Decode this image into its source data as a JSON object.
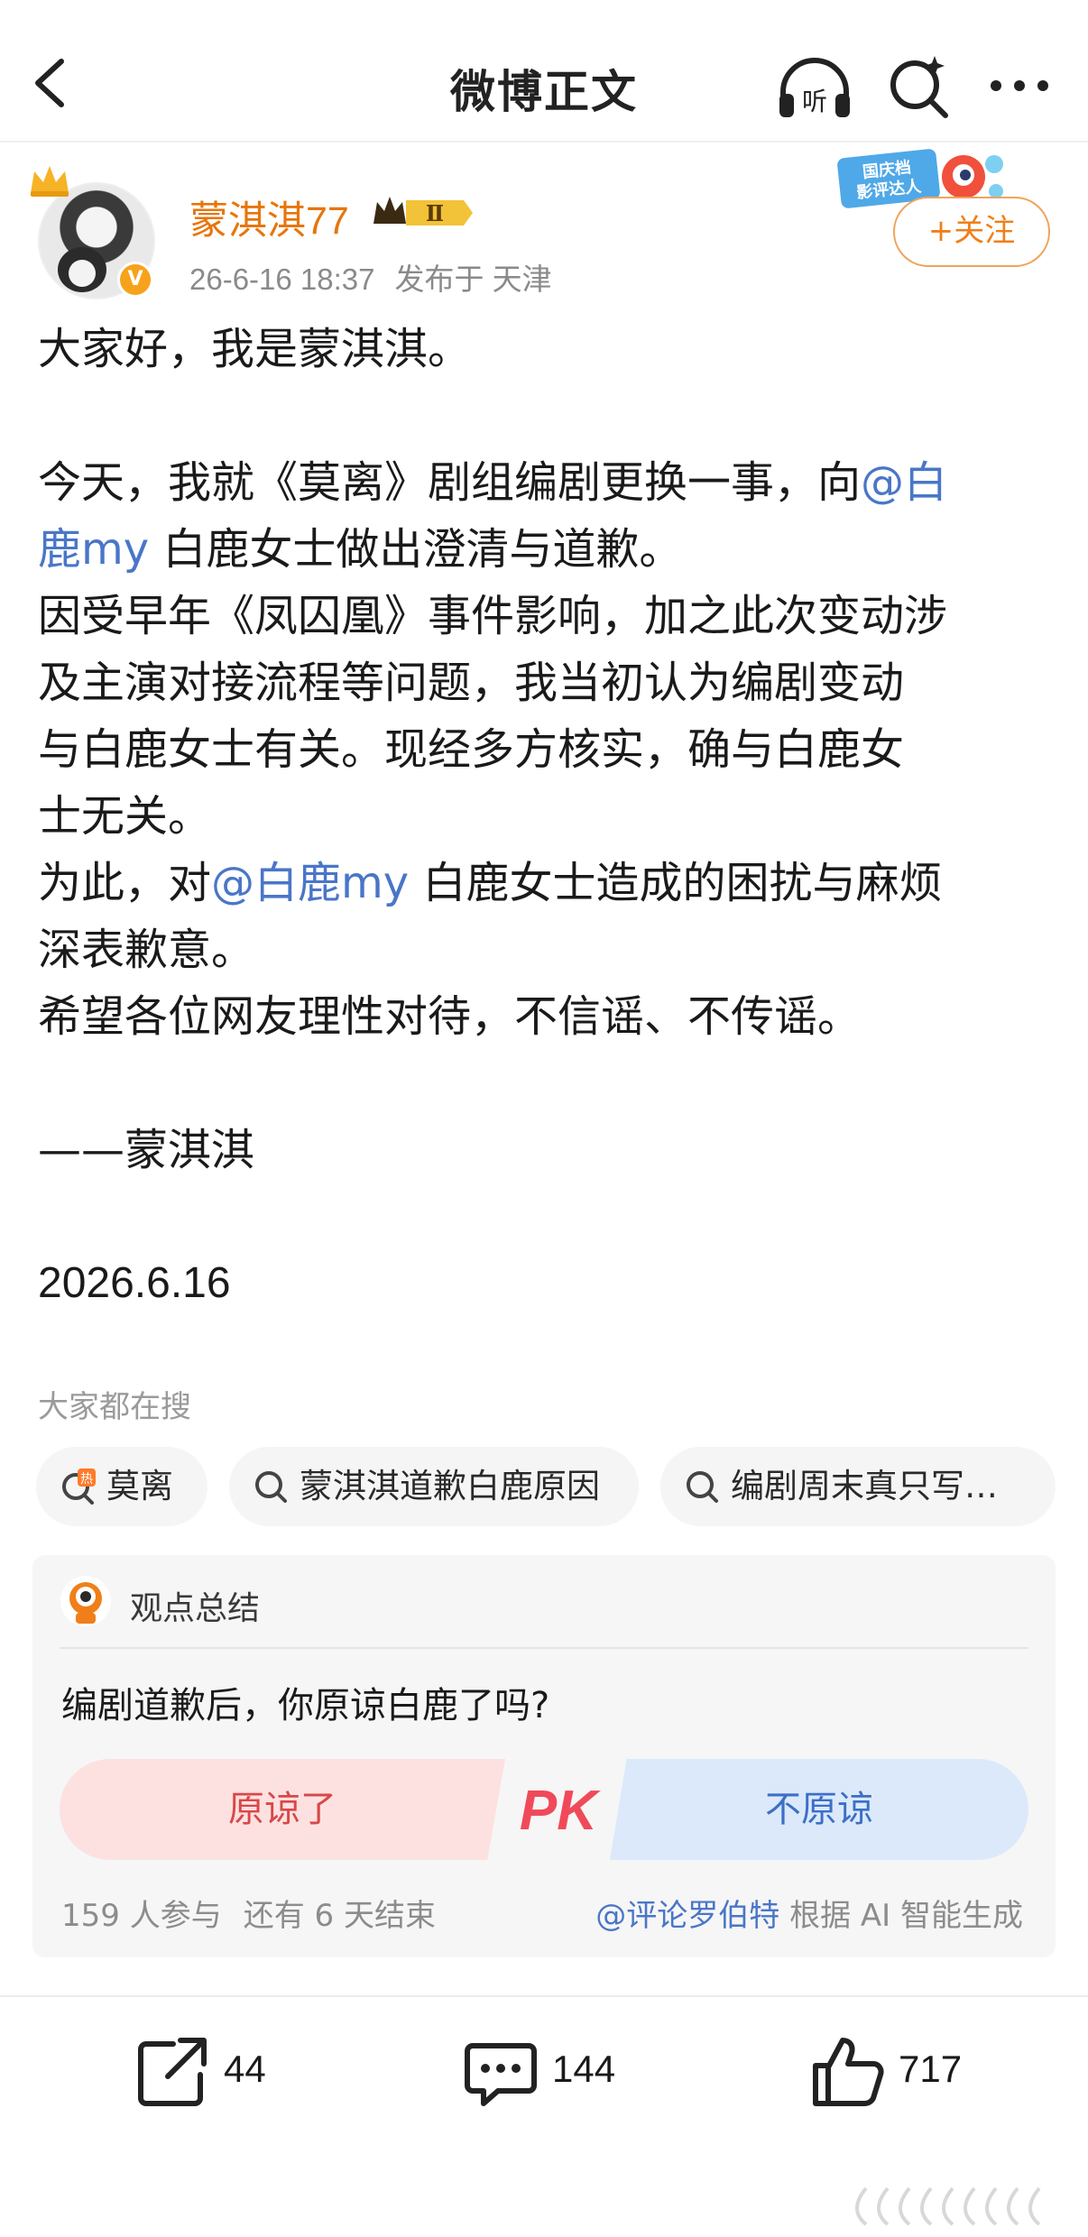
{
  "nav": {
    "title": "微博正文",
    "listen_label": "听"
  },
  "author": {
    "name": "蒙淇淇77",
    "vip_level": "Ⅱ",
    "verified_mark": "V",
    "timestamp": "26-6-16 18:37",
    "location": "发布于 天津",
    "follow_label": "+关注"
  },
  "sticker": {
    "text_line1": "国庆档",
    "text_line2": "影评达人"
  },
  "post": {
    "p1": "大家好，我是蒙淇淇。",
    "p2_a": "今天，我就《莫离》剧组编剧更换一事，向",
    "p2_mention_a": "@白",
    "p2_mention_b": "鹿my",
    "p2_b": " 白鹿女士做出澄清与道歉。",
    "p3_l1": "因受早年《凤囚凰》事件影响，加之此次变动涉",
    "p3_l2": "及主演对接流程等问题，我当初认为编剧变动",
    "p3_l3": "与白鹿女士有关。现经多方核实，确与白鹿女",
    "p3_l4": "士无关。",
    "p4_a": "为此，对",
    "p4_mention": "@白鹿my",
    "p4_b": " 白鹿女士造成的困扰与麻烦",
    "p4_l2": "深表歉意。",
    "p5": "希望各位网友理性对待，不信谣、不传谣。",
    "signature": "——蒙淇淇",
    "date": "2026.6.16"
  },
  "hot_search": {
    "label": "大家都在搜",
    "chips": [
      {
        "text": "莫离",
        "hot_mark": "热"
      },
      {
        "text": "蒙淇淇道歉白鹿原因"
      },
      {
        "text": "编剧周末真只写…"
      }
    ]
  },
  "opinion": {
    "title": "观点总结",
    "question": "编剧道歉后，你原谅白鹿了吗?",
    "yes_label": "原谅了",
    "pk_label": "PK",
    "no_label": "不原谅",
    "participants": "159 人参与",
    "remaining": "还有 6 天结束",
    "source_mention": "@评论罗伯特",
    "source_suffix": "根据 AI 智能生成"
  },
  "actions": {
    "reposts": "44",
    "comments": "144",
    "likes": "717"
  },
  "colors": {
    "name_orange": "#e8750a",
    "mention_blue": "#4a76c8",
    "vote_yes_bg": "#fde1e1",
    "vote_no_bg": "#dbe9fb"
  }
}
